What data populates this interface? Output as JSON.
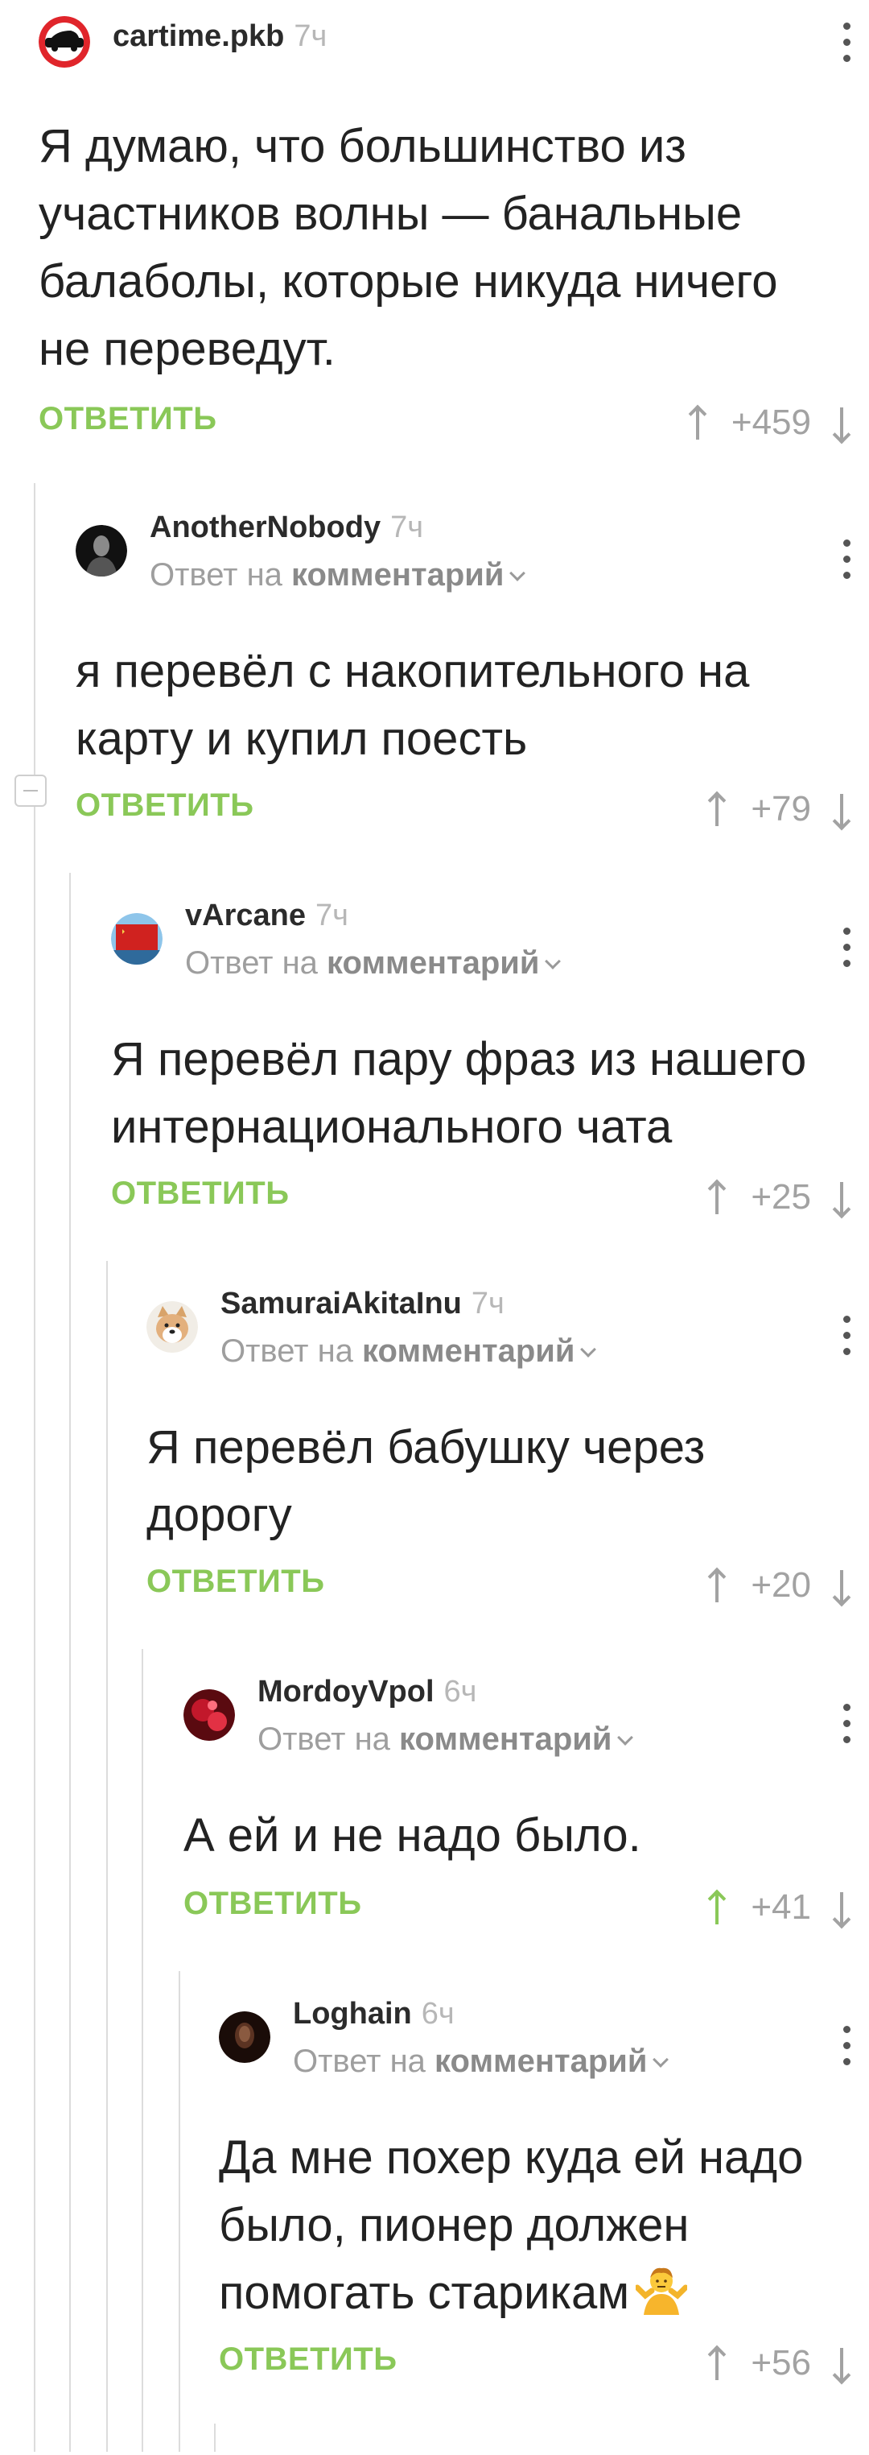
{
  "comments": [
    {
      "nick": "cartime.pkb",
      "time": "7ч",
      "reply_to": "",
      "reply_to_target": "",
      "lines": [
        "Я думаю, что большинство из",
        "участников волны — банальные",
        "балаболы, которые никуда ничего",
        "не переведут."
      ],
      "reply_label": "ОТВЕТИТЬ",
      "rating": "+459",
      "upvoted": false,
      "avatar": "cartime-logo"
    },
    {
      "nick": "AnotherNobody",
      "time": "7ч",
      "reply_to": "Ответ на",
      "reply_to_target": "комментарий",
      "lines": [
        "я перевёл с накопительного на",
        "карту и купил поесть"
      ],
      "reply_label": "ОТВЕТИТЬ",
      "rating": "+79",
      "upvoted": false,
      "avatar": "dark-figure"
    },
    {
      "nick": "vArcane",
      "time": "7ч",
      "reply_to": "Ответ на",
      "reply_to_target": "комментарий",
      "lines": [
        "Я перевёл пару фраз из нашего",
        "интернационального чата"
      ],
      "reply_label": "ОТВЕТИТЬ",
      "rating": "+25",
      "upvoted": false,
      "avatar": "red-flag"
    },
    {
      "nick": "SamuraiAkitaInu",
      "time": "7ч",
      "reply_to": "Ответ на",
      "reply_to_target": "комментарий",
      "lines": [
        "Я перевёл бабушку через",
        "дорогу"
      ],
      "reply_label": "ОТВЕТИТЬ",
      "rating": "+20",
      "upvoted": false,
      "avatar": "akita-dog"
    },
    {
      "nick": "MordoyVpol",
      "time": "6ч",
      "reply_to": "Ответ на",
      "reply_to_target": "комментарий",
      "lines": [
        "А ей и не надо было."
      ],
      "reply_label": "ОТВЕТИТЬ",
      "rating": "+41",
      "upvoted": true,
      "avatar": "red-abstract"
    },
    {
      "nick": "Loghain",
      "time": "6ч",
      "reply_to": "Ответ на",
      "reply_to_target": "комментарий",
      "lines": [
        "Да мне похер куда ей надо",
        "было, пионер должен",
        "помогать старикам"
      ],
      "reply_label": "ОТВЕТИТЬ",
      "rating": "+56",
      "upvoted": false,
      "avatar": "dark-portrait",
      "emoji": "person-shrugging-emoji"
    }
  ],
  "colors": {
    "accent_green": "#8ac858",
    "thread_line": "#dcdcdc",
    "meta_gray": "#9e9e9e"
  }
}
